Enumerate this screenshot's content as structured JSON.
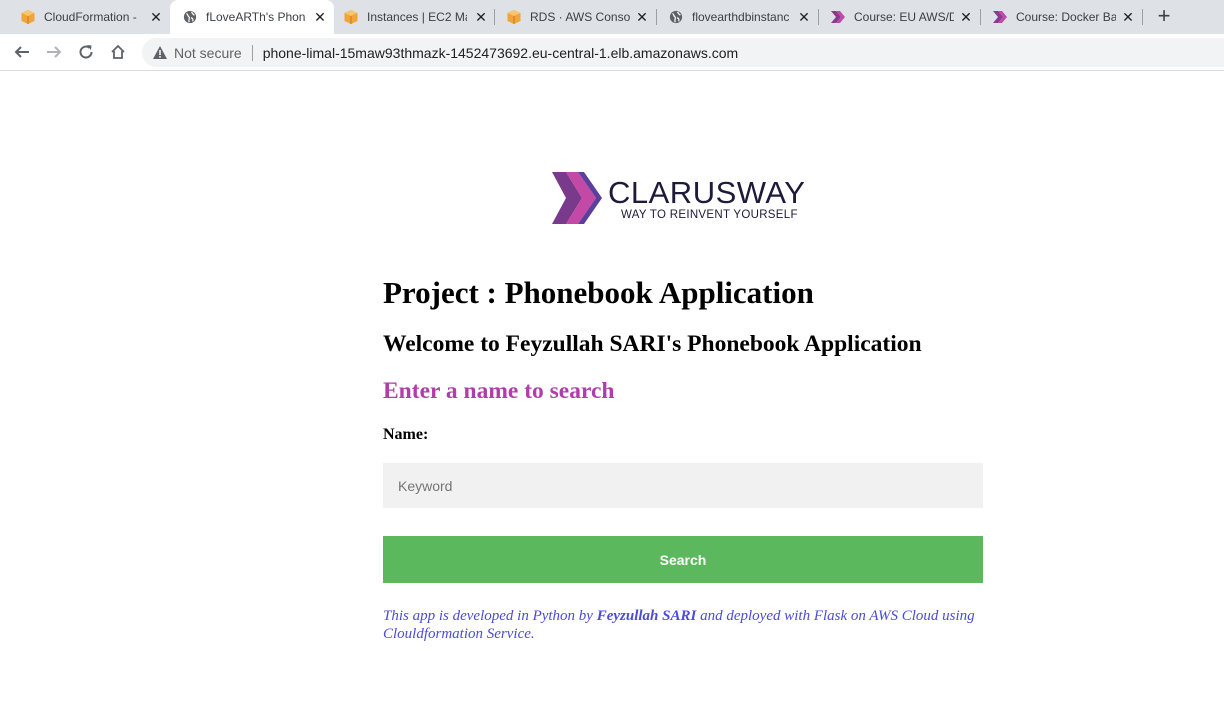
{
  "browser": {
    "tabs": [
      {
        "title": "CloudFormation - ",
        "icon": "aws-box-icon",
        "active": false
      },
      {
        "title": "fLoveARTh's Phone",
        "icon": "globe-icon",
        "active": true
      },
      {
        "title": "Instances | EC2 Ma",
        "icon": "aws-box-icon",
        "active": false
      },
      {
        "title": "RDS · AWS Console",
        "icon": "aws-box-icon",
        "active": false
      },
      {
        "title": "flovearthdbinstanc",
        "icon": "globe-icon",
        "active": false
      },
      {
        "title": "Course: EU AWS/D",
        "icon": "clarusway-chevron-icon",
        "active": false
      },
      {
        "title": "Course: Docker Ba",
        "icon": "clarusway-chevron-icon",
        "active": false
      }
    ],
    "new_tab": "+",
    "security_label": "Not secure",
    "url": "phone-limal-15maw93thmazk-1452473692.eu-central-1.elb.amazonaws.com"
  },
  "logo": {
    "brand": "CLARUSWAY",
    "tagline": "WAY TO REINVENT YOURSELF"
  },
  "page": {
    "project_title": "Project : Phonebook Application",
    "welcome": "Welcome to Feyzullah SARI's Phonebook Application",
    "search_heading": "Enter a name to search",
    "name_label": "Name:",
    "keyword_placeholder": "Keyword",
    "keyword_value": "",
    "search_button": "Search",
    "footer": {
      "prefix": "This app is developed in Python by ",
      "author": "Feyzullah SARI",
      "suffix": " and deployed with Flask on AWS Cloud using Clouldformation Service."
    }
  },
  "colors": {
    "accent_purple": "#b13dac",
    "button_green": "#5cb85c",
    "footer_blue": "#4b4bdb",
    "aws_orange": "#f0a43a"
  }
}
